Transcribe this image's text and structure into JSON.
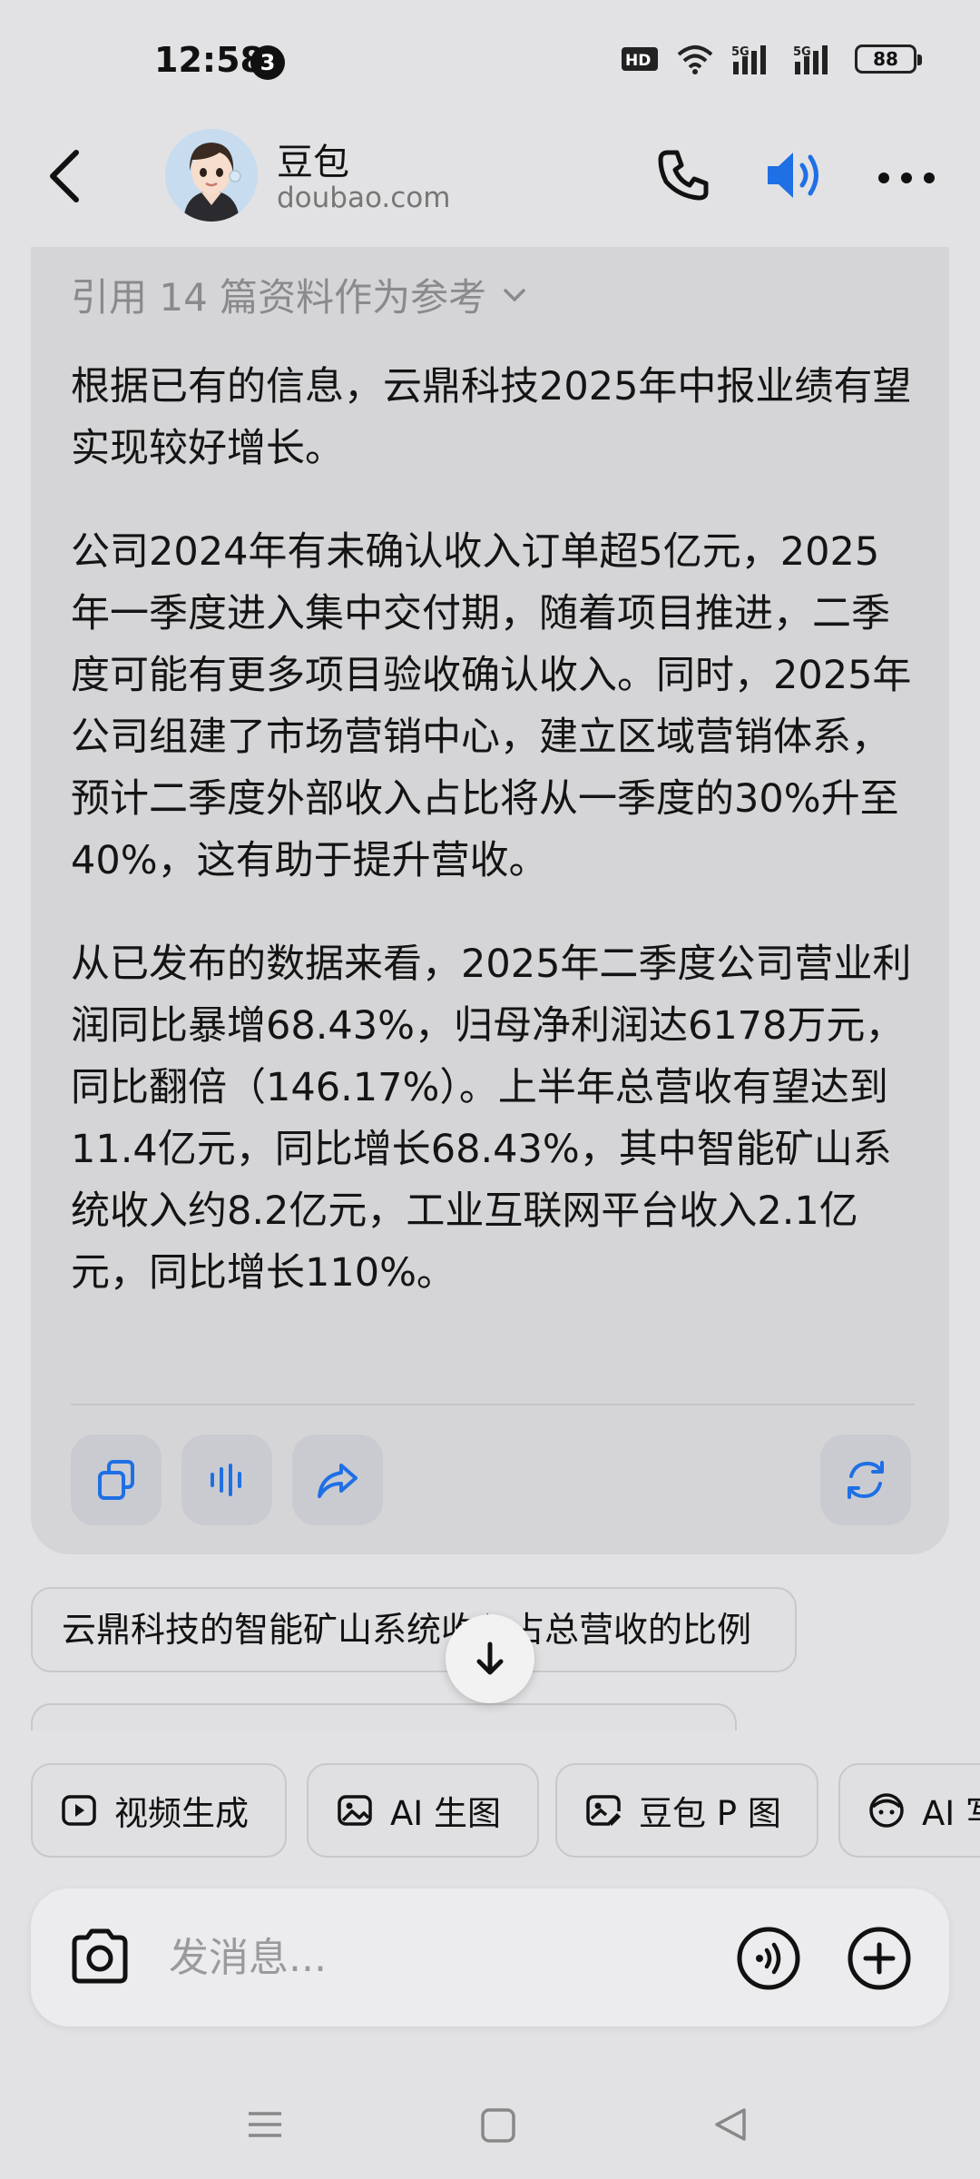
{
  "status_bar": {
    "time": "12:58",
    "notification_count": "3",
    "network_labels": [
      "HD2",
      "5G",
      "5G"
    ],
    "battery": "88"
  },
  "header": {
    "bot_name": "豆包",
    "bot_domain": "doubao.com"
  },
  "answer": {
    "references_label": "引用 14 篇资料作为参考",
    "paragraphs": [
      "根据已有的信息，云鼎科技2025年中报业绩有望实现较好增长。",
      "公司2024年有未确认收入订单超5亿元，2025年一季度进入集中交付期，随着项目推进，二季度可能有更多项目验收确认收入。同时，2025年公司组建了市场营销中心，建立区域营销体系，预计二季度外部收入占比将从一季度的30%升至40%，这有助于提升营收。",
      "从已发布的数据来看，2025年二季度公司营业利润同比暴增68.43%，归母净利润达6178万元，同比翻倍（146.17%）。上半年总营收有望达到11.4亿元，同比增长68.43%，其中智能矿山系统收入约8.2亿元，工业互联网平台收入2.1亿元，同比增长110%。"
    ],
    "actions": [
      "copy-icon",
      "voice-wave-icon",
      "share-icon",
      "regenerate-icon"
    ]
  },
  "suggestions": [
    "云鼎科技的智能矿山系统收入占总营收的比例"
  ],
  "tools": [
    {
      "label": "视频生成",
      "icon": "video-play-icon"
    },
    {
      "label": "AI 生图",
      "icon": "image-icon"
    },
    {
      "label": "豆包 P 图",
      "icon": "photo-edit-icon"
    },
    {
      "label": "AI 写",
      "icon": "face-icon"
    }
  ],
  "input": {
    "placeholder": "发消息..."
  },
  "colors": {
    "accent": "#1f6fe5",
    "card_bg": "#d5d5d7",
    "page_bg": "#e2e2e4"
  }
}
